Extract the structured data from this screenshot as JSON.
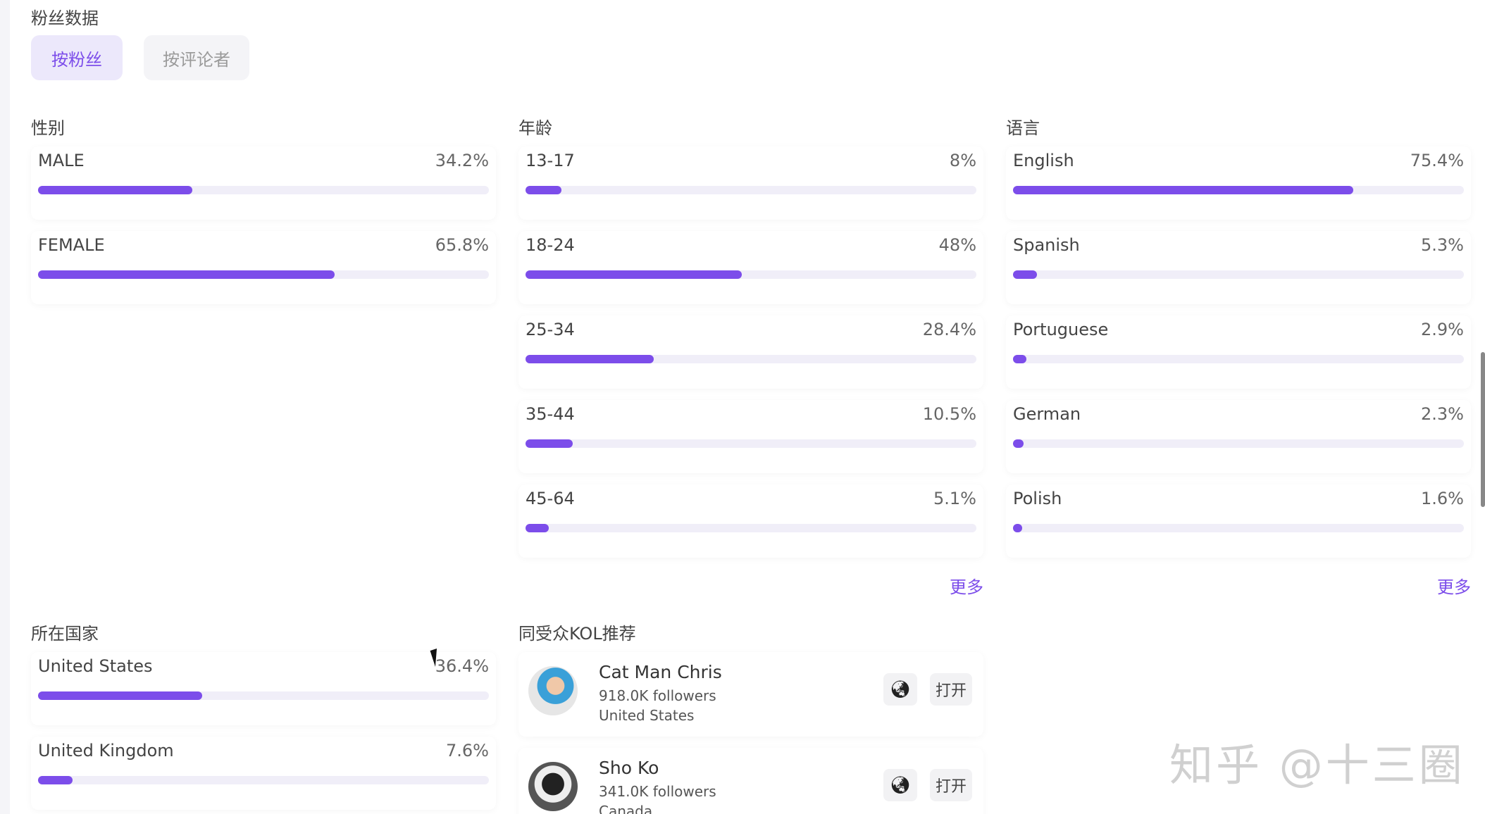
{
  "page_title": "粉丝数据",
  "tabs": {
    "fans": "按粉丝",
    "commenters": "按评论者"
  },
  "sections": {
    "gender": "性别",
    "age": "年龄",
    "language": "语言",
    "country": "所在国家",
    "kol": "同受众KOL推荐"
  },
  "more_label": "更多",
  "gender": [
    {
      "label": "MALE",
      "pct": "34.2%",
      "value": 34.2
    },
    {
      "label": "FEMALE",
      "pct": "65.8%",
      "value": 65.8
    }
  ],
  "age": [
    {
      "label": "13-17",
      "pct": "8%",
      "value": 8
    },
    {
      "label": "18-24",
      "pct": "48%",
      "value": 48
    },
    {
      "label": "25-34",
      "pct": "28.4%",
      "value": 28.4
    },
    {
      "label": "35-44",
      "pct": "10.5%",
      "value": 10.5
    },
    {
      "label": "45-64",
      "pct": "5.1%",
      "value": 5.1
    }
  ],
  "language": [
    {
      "label": "English",
      "pct": "75.4%",
      "value": 75.4
    },
    {
      "label": "Spanish",
      "pct": "5.3%",
      "value": 5.3
    },
    {
      "label": "Portuguese",
      "pct": "2.9%",
      "value": 2.9
    },
    {
      "label": "German",
      "pct": "2.3%",
      "value": 2.3
    },
    {
      "label": "Polish",
      "pct": "1.6%",
      "value": 1.6
    }
  ],
  "country": [
    {
      "label": "United States",
      "pct": "36.4%",
      "value": 36.4
    },
    {
      "label": "United Kingdom",
      "pct": "7.6%",
      "value": 7.6
    }
  ],
  "kols": [
    {
      "name": "Cat Man Chris",
      "followers": "918.0K followers",
      "country": "United States",
      "open": "打开",
      "globe_icon": "globe-icon"
    },
    {
      "name": "Sho Ko",
      "followers": "341.0K followers",
      "country": "Canada",
      "open": "打开",
      "globe_icon": "globe-icon"
    }
  ],
  "watermark": "知乎 @十三圈",
  "accent_color": "#7c4dea"
}
